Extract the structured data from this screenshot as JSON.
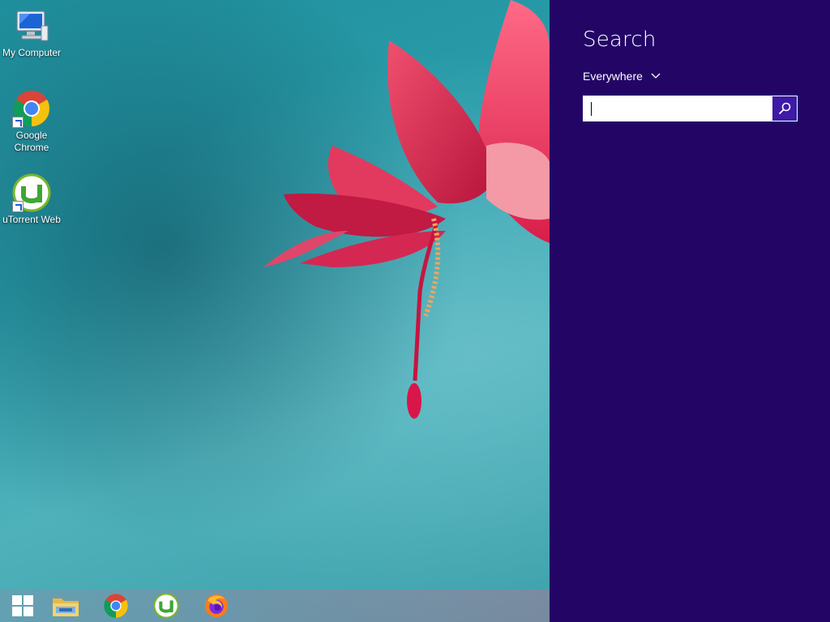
{
  "desktop": {
    "icons": [
      {
        "label": "My Computer",
        "icon": "my-computer-icon"
      },
      {
        "label": "Google Chrome",
        "icon": "chrome-icon"
      },
      {
        "label": "uTorrent Web",
        "icon": "utorrent-icon"
      }
    ]
  },
  "taskbar": {
    "items": [
      {
        "icon": "windows-start-icon"
      },
      {
        "icon": "file-explorer-icon"
      },
      {
        "icon": "chrome-icon"
      },
      {
        "icon": "utorrent-icon"
      },
      {
        "icon": "firefox-icon"
      }
    ]
  },
  "search_charm": {
    "title": "Search",
    "scope": "Everywhere",
    "input_value": "",
    "background": "#230566",
    "button_color": "#3d1ba6"
  }
}
